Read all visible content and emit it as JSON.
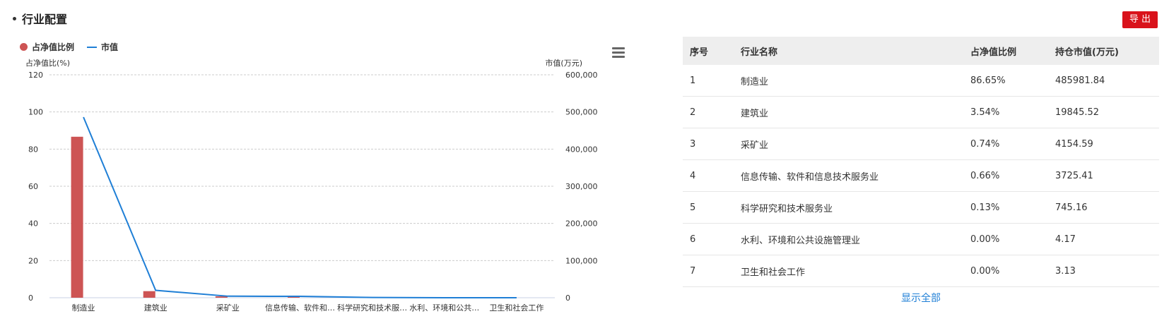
{
  "section": {
    "title": "行业配置"
  },
  "toolbar": {
    "export_label": "导 出"
  },
  "legend": {
    "items": [
      "占净值比例",
      "市值"
    ]
  },
  "axes": {
    "left_label": "占净值比(%)",
    "right_label": "市值(万元)"
  },
  "colors": {
    "bar": "#cd5454",
    "line": "#1f7fd6",
    "export_bg": "#d9121b"
  },
  "chart_data": {
    "type": "bar",
    "categories": [
      "制造业",
      "建筑业",
      "采矿业",
      "信息传输、软件和…",
      "科学研究和技术服…",
      "水利、环境和公共…",
      "卫生和社会工作"
    ],
    "series": [
      {
        "name": "占净值比例",
        "type": "bar",
        "axis": "left",
        "values": [
          86.65,
          3.54,
          0.74,
          0.66,
          0.13,
          0.0,
          0.0
        ]
      },
      {
        "name": "市值",
        "type": "line",
        "axis": "right",
        "values": [
          485981.84,
          19845.52,
          4154.59,
          3725.41,
          745.16,
          4.17,
          3.13
        ]
      }
    ],
    "ylabel": "占净值比(%)",
    "y2label": "市值(万元)",
    "ylim": [
      0,
      120
    ],
    "y2lim": [
      0,
      600000
    ],
    "yticks": [
      "0",
      "20",
      "40",
      "60",
      "80",
      "100",
      "120"
    ],
    "y2ticks": [
      "0",
      "100,000",
      "200,000",
      "300,000",
      "400,000",
      "500,000",
      "600,000"
    ],
    "grid": true,
    "legend_position": "top-left"
  },
  "table": {
    "headers": [
      "序号",
      "行业名称",
      "占净值比例",
      "持仓市值(万元)"
    ],
    "rows": [
      [
        "1",
        "制造业",
        "86.65%",
        "485981.84"
      ],
      [
        "2",
        "建筑业",
        "3.54%",
        "19845.52"
      ],
      [
        "3",
        "采矿业",
        "0.74%",
        "4154.59"
      ],
      [
        "4",
        "信息传输、软件和信息技术服务业",
        "0.66%",
        "3725.41"
      ],
      [
        "5",
        "科学研究和技术服务业",
        "0.13%",
        "745.16"
      ],
      [
        "6",
        "水利、环境和公共设施管理业",
        "0.00%",
        "4.17"
      ],
      [
        "7",
        "卫生和社会工作",
        "0.00%",
        "3.13"
      ]
    ]
  },
  "footer": {
    "show_all_label": "显示全部"
  }
}
